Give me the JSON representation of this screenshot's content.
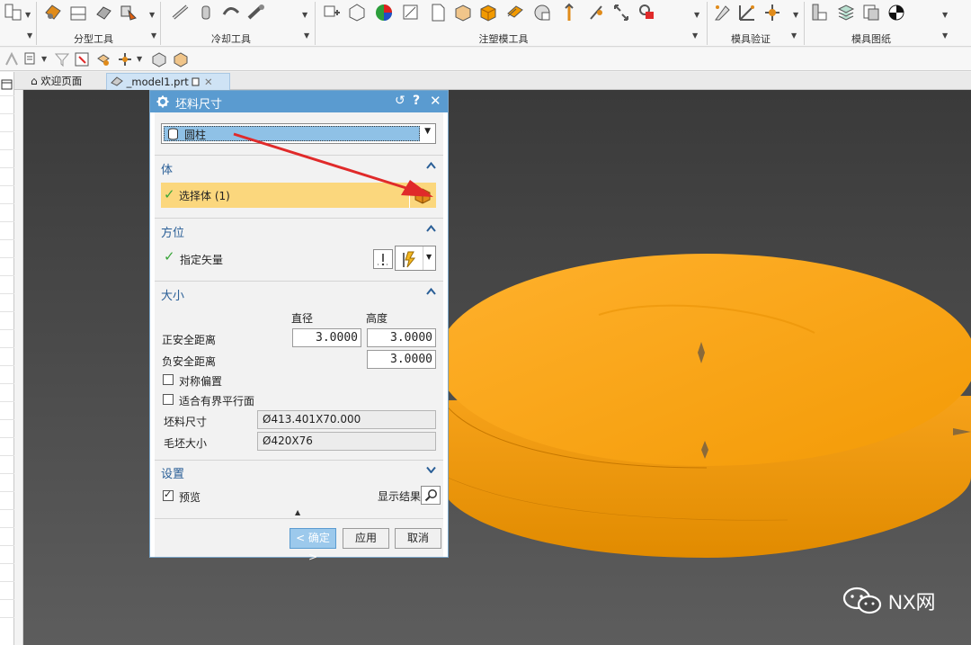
{
  "ribbon": {
    "groups": [
      {
        "label": "分型工具"
      },
      {
        "label": "冷却工具"
      },
      {
        "label": "注塑模工具"
      },
      {
        "label": "模具验证"
      },
      {
        "label": "模具图纸"
      }
    ]
  },
  "tabs": [
    {
      "label": "欢迎页面"
    },
    {
      "label": "_model1.prt"
    }
  ],
  "dialog": {
    "title": "坯料尺寸",
    "shape_select": {
      "value": "圆柱"
    },
    "sections": {
      "body": {
        "title": "体",
        "select_label": "选择体 (1)"
      },
      "orientation": {
        "title": "方位",
        "vector_label": "指定矢量"
      },
      "size": {
        "title": "大小",
        "col_diameter": "直径",
        "col_height": "高度",
        "pos_clearance_label": "正安全距离",
        "pos_diameter": "3.0000",
        "pos_height": "3.0000",
        "neg_clearance_label": "负安全距离",
        "neg_height": "3.0000",
        "symmetric_offset": "对称偏置",
        "fit_bounded_plane": "适合有界平行面",
        "stock_size_label": "坯料尺寸",
        "stock_size": "Ø413.401X70.000",
        "blank_size_label": "毛坯大小",
        "blank_size": "Ø420X76"
      },
      "settings": {
        "title": "设置",
        "preview_label": "预览",
        "show_result_label": "显示结果"
      }
    },
    "buttons": {
      "ok": "< 确定 >",
      "apply": "应用",
      "cancel": "取消"
    }
  },
  "colors": {
    "model": "#f29a00",
    "title_bar": "#5a9bd0",
    "section_title": "#2a5f97",
    "select_highlight": "#fbd77d",
    "arrow": "#e02a2a"
  },
  "watermark": {
    "text": "NX网"
  }
}
